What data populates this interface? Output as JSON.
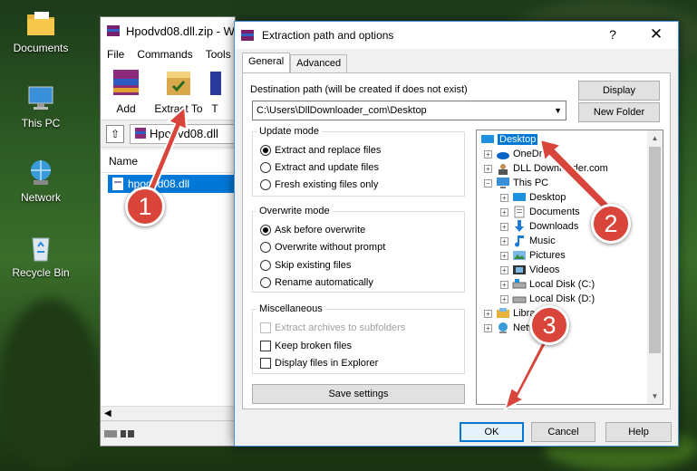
{
  "desktop": {
    "icons": [
      {
        "label": "Documents",
        "icon": "folder-icon"
      },
      {
        "label": "This PC",
        "icon": "computer-icon"
      },
      {
        "label": "Network",
        "icon": "network-icon"
      },
      {
        "label": "Recycle Bin",
        "icon": "recycle-bin-icon"
      }
    ]
  },
  "winrar": {
    "title": "Hpodvd08.dll.zip - W",
    "menu": [
      "File",
      "Commands",
      "Tools"
    ],
    "toolbar": [
      "Add",
      "Extract To",
      "T"
    ],
    "path": "Hpodvd08.dll",
    "column_name": "Name",
    "file": "hpodvd08.dll"
  },
  "dialog": {
    "title": "Extraction path and options",
    "help": "?",
    "close": "✕",
    "tabs": [
      "General",
      "Advanced"
    ],
    "dest_label": "Destination path (will be created if does not exist)",
    "dest_value": "C:\\Users\\DllDownloader_com\\Desktop",
    "display_btn": "Display",
    "new_folder_btn": "New Folder",
    "update_mode": {
      "title": "Update mode",
      "options": [
        "Extract and replace files",
        "Extract and update files",
        "Fresh existing files only"
      ],
      "selected": 0
    },
    "overwrite_mode": {
      "title": "Overwrite mode",
      "options": [
        "Ask before overwrite",
        "Overwrite without prompt",
        "Skip existing files",
        "Rename automatically"
      ],
      "selected": 0
    },
    "misc": {
      "title": "Miscellaneous",
      "options": [
        "Extract archives to subfolders",
        "Keep broken files",
        "Display files in Explorer"
      ]
    },
    "save_settings": "Save settings",
    "tree": [
      {
        "label": "Desktop",
        "icon": "desktop-icon"
      },
      {
        "label": "OneDrive",
        "icon": "onedrive-icon"
      },
      {
        "label": "DLL Downloader.com",
        "icon": "user-icon"
      },
      {
        "label": "This PC",
        "icon": "computer-icon"
      },
      {
        "label": "Desktop",
        "icon": "desktop-icon"
      },
      {
        "label": "Documents",
        "icon": "documents-icon"
      },
      {
        "label": "Downloads",
        "icon": "downloads-icon"
      },
      {
        "label": "Music",
        "icon": "music-icon"
      },
      {
        "label": "Pictures",
        "icon": "pictures-icon"
      },
      {
        "label": "Videos",
        "icon": "videos-icon"
      },
      {
        "label": "Local Disk (C:)",
        "icon": "drive-icon"
      },
      {
        "label": "Local Disk (D:)",
        "icon": "drive-icon"
      },
      {
        "label": "Libraries",
        "icon": "library-icon"
      },
      {
        "label": "Network",
        "icon": "network-icon"
      }
    ],
    "ok": "OK",
    "cancel": "Cancel",
    "help_btn": "Help"
  },
  "steps": [
    "1",
    "2",
    "3"
  ],
  "colors": {
    "accent": "#0078d7",
    "badge": "#d9453b"
  }
}
